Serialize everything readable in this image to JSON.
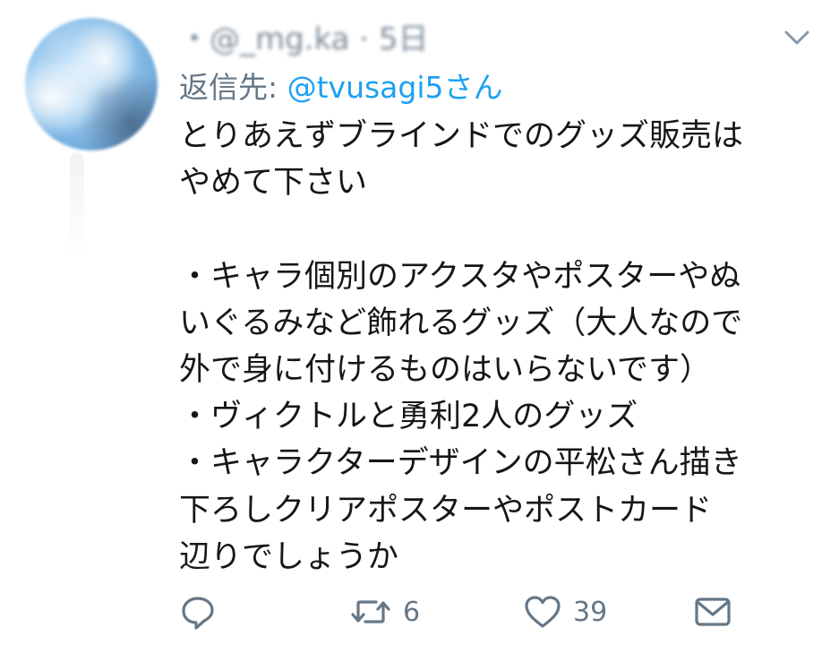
{
  "tweet": {
    "header_text": "・@_mg.ka · 5日",
    "reply_label": "返信先: ",
    "reply_handle": "@tvusagi5さん",
    "body_lines": [
      "とりあえずブラインドでのグッズ販売は",
      "やめて下さい",
      "",
      "・キャラ個別のアクスタやポスターやぬ",
      "いぐるみなど飾れるグッズ（大人なので",
      "外で身に付けるものはいらないです）",
      "・ヴィクトルと勇利2人のグッズ",
      "・キャラクターデザインの平松さん描き",
      "下ろしクリアポスターやポストカード",
      "辺りでしょうか"
    ]
  },
  "actions": {
    "reply_icon": "reply-bubble-icon",
    "retweet_icon": "retweet-icon",
    "retweet_count": "6",
    "like_icon": "heart-icon",
    "like_count": "39",
    "dm_icon": "envelope-icon"
  },
  "colors": {
    "text": "#14171a",
    "secondary": "#657786",
    "link": "#1da1f2"
  }
}
